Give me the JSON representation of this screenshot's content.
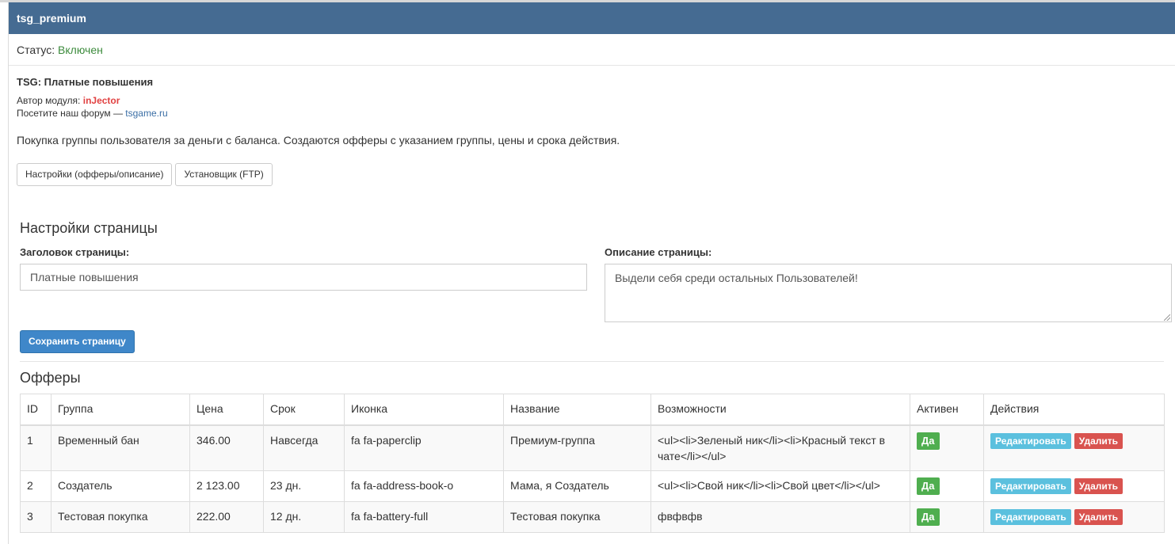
{
  "panel": {
    "title": "tsg_premium",
    "status_label": "Статус:",
    "status_value": "Включен"
  },
  "module": {
    "title": "TSG: Платные повышения",
    "author_label": "Автор модуля:",
    "author_name": "inJector",
    "forum_label": "Посетите наш форум —",
    "forum_link": "tsgame.ru",
    "description": "Покупка группы пользователя за деньги с баланса. Создаются офферы с указанием группы, цены и срока действия."
  },
  "tabs": {
    "settings": "Настройки (офферы/описание)",
    "installer": "Установщик (FTP)"
  },
  "page_settings": {
    "heading": "Настройки страницы",
    "title_label": "Заголовок страницы:",
    "title_value": "Платные повышения",
    "desc_label": "Описание страницы:",
    "desc_value": "Выдели себя среди остальных Пользователей!",
    "save_label": "Сохранить страницу"
  },
  "offers": {
    "heading": "Офферы",
    "columns": [
      "ID",
      "Группа",
      "Цена",
      "Срок",
      "Иконка",
      "Название",
      "Возможности",
      "Активен",
      "Действия"
    ],
    "rows": [
      {
        "id": "1",
        "group": "Временный бан",
        "price": "346.00",
        "term": "Навсегда",
        "icon": "fa fa-paperclip",
        "name": "Премиум-группа",
        "features": "<ul><li>Зеленый ник</li><li>Красный текст в чате</li></ul>",
        "active": "Да"
      },
      {
        "id": "2",
        "group": "Создатель",
        "price": "2 123.00",
        "term": "23 дн.",
        "icon": "fa fa-address-book-o",
        "name": "Мама, я Создатель",
        "features": "<ul><li>Свой ник</li><li>Свой цвет</li></ul>",
        "active": "Да"
      },
      {
        "id": "3",
        "group": "Тестовая покупка",
        "price": "222.00",
        "term": "12 дн.",
        "icon": "fa fa-battery-full",
        "name": "Тестовая покупка",
        "features": "фвфвфв",
        "active": "Да"
      }
    ],
    "edit_label": "Редактировать",
    "delete_label": "Удалить"
  }
}
